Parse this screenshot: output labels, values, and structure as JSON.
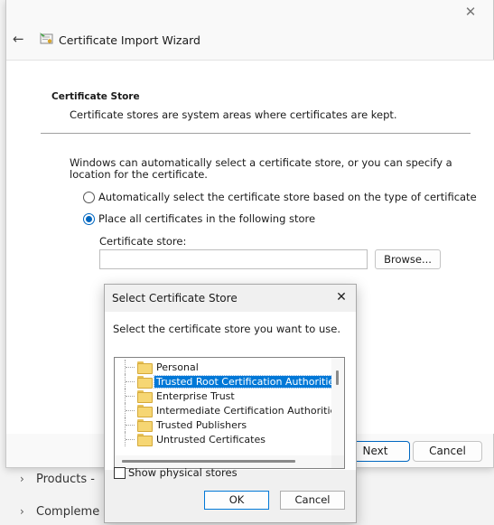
{
  "background": {
    "nav_items": [
      {
        "label": "Products -"
      },
      {
        "label": "Compleme"
      }
    ]
  },
  "wizard": {
    "title": "Certificate Import Wizard",
    "section_title": "Certificate Store",
    "section_desc": "Certificate stores are system areas where certificates are kept.",
    "intro": "Windows can automatically select a certificate store, or you can specify a location for the certificate.",
    "radio_auto": "Automatically select the certificate store based on the type of certificate",
    "radio_manual": "Place all certificates in the following store",
    "selected_option": "radio_manual",
    "store_label": "Certificate store:",
    "store_value": "",
    "browse_label": "Browse...",
    "next_label": "Next",
    "cancel_label": "Cancel"
  },
  "dialog": {
    "title": "Select Certificate Store",
    "prompt": "Select the certificate store you want to use.",
    "stores": [
      {
        "label": "Personal",
        "selected": false
      },
      {
        "label": "Trusted Root Certification Authorities",
        "selected": true
      },
      {
        "label": "Enterprise Trust",
        "selected": false
      },
      {
        "label": "Intermediate Certification Authorities",
        "selected": false
      },
      {
        "label": "Trusted Publishers",
        "selected": false
      },
      {
        "label": "Untrusted Certificates",
        "selected": false
      }
    ],
    "show_physical_label": "Show physical stores",
    "show_physical_checked": false,
    "ok_label": "OK",
    "cancel_label": "Cancel"
  },
  "icons": {
    "wizard_close": "close-icon",
    "back": "back-arrow-icon",
    "wizard": "certificate-icon",
    "dialog_close": "close-icon",
    "folder": "folder-icon",
    "chevron": "chevron-right-icon"
  },
  "colors": {
    "accent": "#0067c0",
    "selection": "#0078d7"
  }
}
